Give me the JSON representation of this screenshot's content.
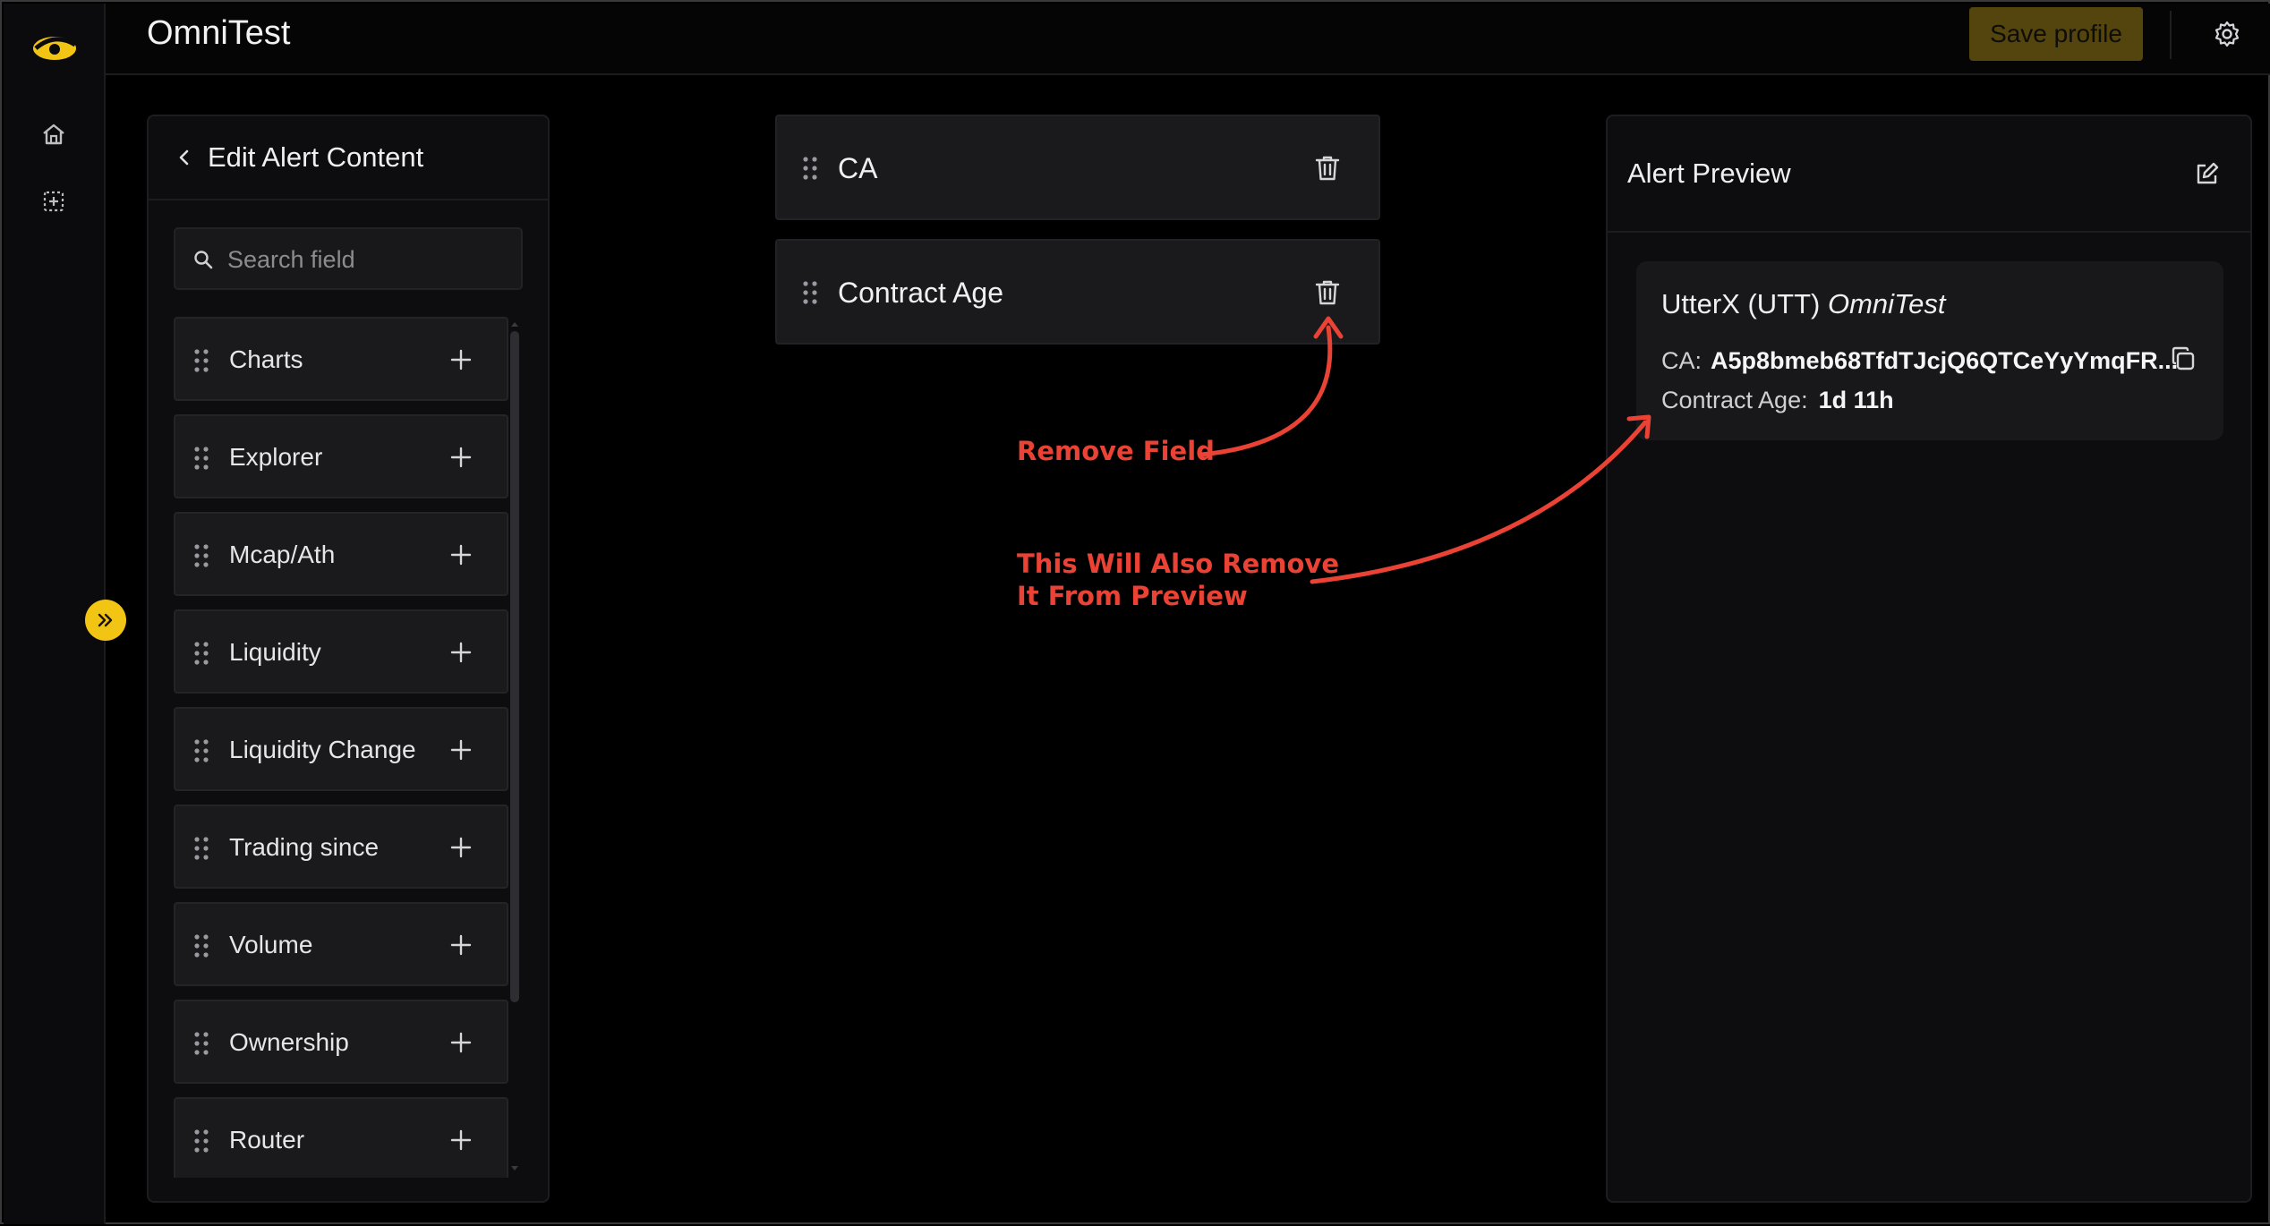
{
  "header": {
    "app_title": "OmniTest",
    "save_label": "Save profile"
  },
  "rail": {
    "icons": [
      "logo-icon",
      "home-icon",
      "dashboard-icon"
    ],
    "expand_icon": "double-chevron-right-icon",
    "accent_color": "#f2c514"
  },
  "left_panel": {
    "title": "Edit Alert Content",
    "search": {
      "placeholder": "Search field",
      "value": ""
    },
    "fields": [
      {
        "label": "Charts"
      },
      {
        "label": "Explorer"
      },
      {
        "label": "Mcap/Ath"
      },
      {
        "label": "Liquidity"
      },
      {
        "label": "Liquidity Change"
      },
      {
        "label": "Trading since"
      },
      {
        "label": "Volume"
      },
      {
        "label": "Ownership"
      },
      {
        "label": "Router"
      }
    ]
  },
  "selected_fields": [
    {
      "label": "CA"
    },
    {
      "label": "Contract Age"
    }
  ],
  "preview": {
    "title": "Alert Preview",
    "token_name": "UtterX (UTT)",
    "profile_name": "OmniTest",
    "ca_label": "CA:",
    "ca_value": "A5p8bmeb68TfdTJcjQ6QTCeYyYmqFR...",
    "age_label": "Contract Age:",
    "age_value": "1d 11h"
  },
  "annotations": {
    "remove_field": "Remove Field",
    "remove_preview_line1": "This Will Also Remove",
    "remove_preview_line2": "It From Preview",
    "color": "#ea4335"
  }
}
